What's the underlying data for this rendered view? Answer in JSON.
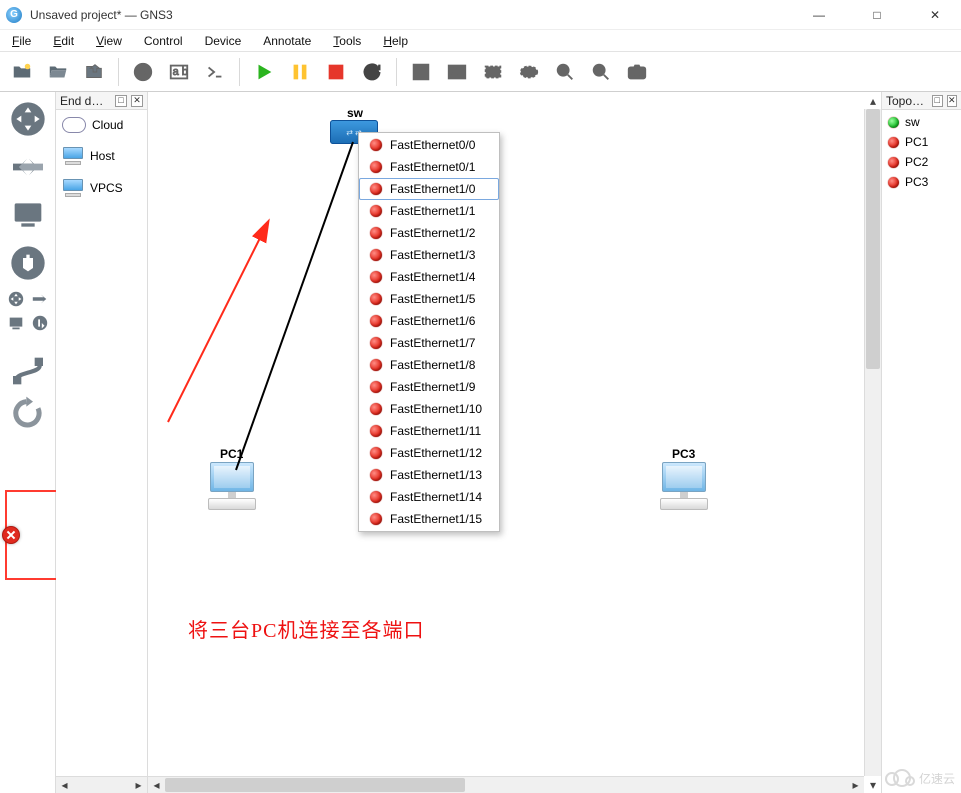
{
  "window": {
    "title": "Unsaved project* — GNS3",
    "minimize": "—",
    "maximize": "□",
    "close": "✕"
  },
  "menu": {
    "file": "File",
    "edit": "Edit",
    "view": "View",
    "control": "Control",
    "device": "Device",
    "annotate": "Annotate",
    "tools": "Tools",
    "help": "Help"
  },
  "panels": {
    "enddev_title": "End d…",
    "topo_title": "Topo…"
  },
  "enddev": {
    "items": [
      {
        "label": "Cloud"
      },
      {
        "label": "Host"
      },
      {
        "label": "VPCS"
      }
    ]
  },
  "canvas": {
    "sw_label": "sw",
    "pc1_label": "PC1",
    "pc3_label": "PC3",
    "annotation": "将三台PC机连接至各端口"
  },
  "context_menu": {
    "selected_index": 2,
    "items": [
      "FastEthernet0/0",
      "FastEthernet0/1",
      "FastEthernet1/0",
      "FastEthernet1/1",
      "FastEthernet1/2",
      "FastEthernet1/3",
      "FastEthernet1/4",
      "FastEthernet1/5",
      "FastEthernet1/6",
      "FastEthernet1/7",
      "FastEthernet1/8",
      "FastEthernet1/9",
      "FastEthernet1/10",
      "FastEthernet1/11",
      "FastEthernet1/12",
      "FastEthernet1/13",
      "FastEthernet1/14",
      "FastEthernet1/15"
    ]
  },
  "topo": {
    "items": [
      {
        "label": "sw",
        "status": "green"
      },
      {
        "label": "PC1",
        "status": "red"
      },
      {
        "label": "PC2",
        "status": "red"
      },
      {
        "label": "PC3",
        "status": "red"
      }
    ]
  },
  "watermark": "亿速云"
}
